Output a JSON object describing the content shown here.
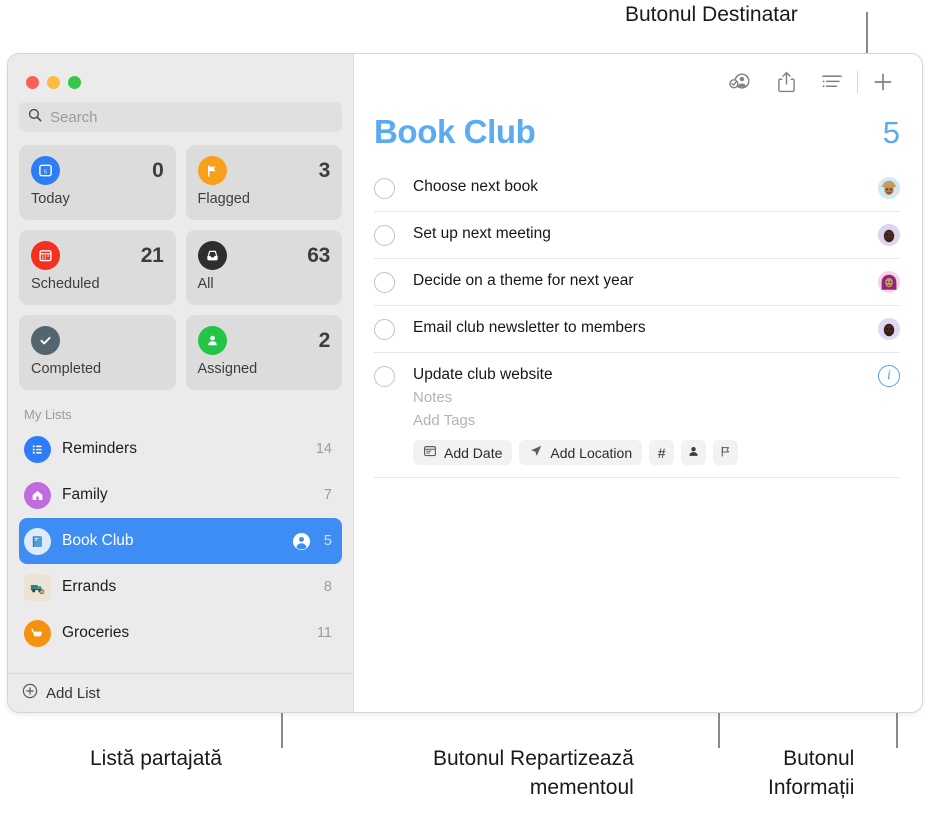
{
  "callouts": [
    {
      "id": "recipient",
      "text": "Butonul Destinatar"
    },
    {
      "id": "shared_list",
      "text": "Listă partajată"
    },
    {
      "id": "assign",
      "text": "Butonul Repartizează\nmementoul"
    },
    {
      "id": "info",
      "text": "Butonul\nInformații"
    }
  ],
  "window": {
    "traffic_lights": [
      "close",
      "minimize",
      "zoom"
    ]
  },
  "sidebar": {
    "search": {
      "placeholder": "Search",
      "value": ""
    },
    "smart_lists": [
      {
        "label": "Today",
        "count": "0",
        "icon": "calendar-day-icon",
        "color": "#2e7df6"
      },
      {
        "label": "Flagged",
        "count": "3",
        "icon": "flag-icon",
        "color": "#f8a01c"
      },
      {
        "label": "Scheduled",
        "count": "21",
        "icon": "calendar-icon",
        "color": "#f62f1e"
      },
      {
        "label": "All",
        "count": "63",
        "icon": "inbox-icon",
        "color": "#2e2e2e"
      },
      {
        "label": "Completed",
        "count": "",
        "icon": "checkmark-icon",
        "color": "#53656e"
      },
      {
        "label": "Assigned",
        "count": "2",
        "icon": "person-icon",
        "color": "#22c546"
      }
    ],
    "my_lists_header": "My Lists",
    "lists": [
      {
        "name": "Reminders",
        "count": "14",
        "icon": "list-bullet-icon",
        "color": "#2e7df6",
        "glyph": "☰",
        "shared": false,
        "selected": false
      },
      {
        "name": "Family",
        "count": "7",
        "icon": "house-icon",
        "color": "#c06ce0",
        "glyph": "⌂",
        "shared": false,
        "selected": false
      },
      {
        "name": "Book Club",
        "count": "5",
        "icon": "book-icon",
        "color": "#dceafa",
        "glyph": "📘",
        "shared": true,
        "selected": true
      },
      {
        "name": "Errands",
        "count": "8",
        "icon": "truck-icon",
        "color": "#ebe3d4",
        "glyph": "🚚",
        "shared": false,
        "selected": false
      },
      {
        "name": "Groceries",
        "count": "11",
        "icon": "cart-icon",
        "color": "#f5910f",
        "glyph": "🛒",
        "shared": false,
        "selected": false
      }
    ],
    "add_list_label": "Add List"
  },
  "main": {
    "toolbar": [
      {
        "id": "recipient",
        "icon": "person-badge-check-icon"
      },
      {
        "id": "share",
        "icon": "share-icon"
      },
      {
        "id": "sort",
        "icon": "list-sort-icon"
      },
      {
        "id": "add",
        "icon": "plus-icon"
      }
    ],
    "title": "Book Club",
    "total_count": "5",
    "accent_color": "#5aabf2",
    "reminders": [
      {
        "title": "Choose next book",
        "avatar": "avatar-1",
        "avatar_bg": "#cfe9f7",
        "avatar_glyph": "🧑🏽‍🌾",
        "expanded": false
      },
      {
        "title": "Set up next meeting",
        "avatar": "avatar-2",
        "avatar_bg": "#ddd4f0",
        "avatar_glyph": "🧔🏿",
        "expanded": false
      },
      {
        "title": "Decide on a theme for next year",
        "avatar": "avatar-3",
        "avatar_bg": "#f9d3e3",
        "avatar_glyph": "🧕🏽",
        "expanded": false
      },
      {
        "title": "Email club newsletter to members",
        "avatar": "avatar-4",
        "avatar_bg": "#e0d9f3",
        "avatar_glyph": "🧔🏿",
        "expanded": false
      },
      {
        "title": "Update club website",
        "avatar": "info",
        "avatar_bg": "",
        "avatar_glyph": "",
        "expanded": true,
        "notes_placeholder": "Notes",
        "tags_placeholder": "Add Tags",
        "actions": [
          {
            "id": "add-date",
            "label": "Add Date",
            "icon": "calendar-icon"
          },
          {
            "id": "add-location",
            "label": "Add Location",
            "icon": "location-arrow-icon"
          },
          {
            "id": "add-tag",
            "label": "#",
            "icon": "hash-icon"
          },
          {
            "id": "assign",
            "label": "",
            "icon": "person-fill-icon"
          },
          {
            "id": "flag",
            "label": "",
            "icon": "flag-outline-icon"
          }
        ]
      }
    ]
  }
}
